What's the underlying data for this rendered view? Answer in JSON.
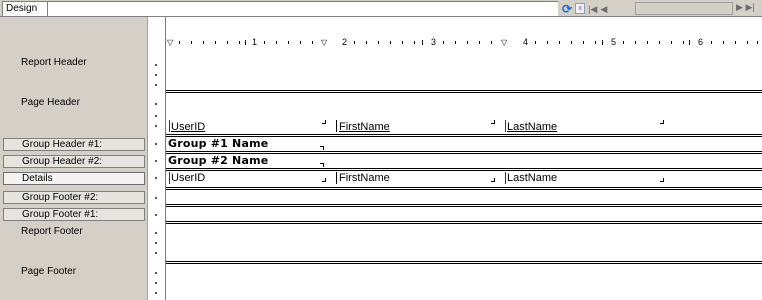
{
  "tab": {
    "label": "Design"
  },
  "sections": [
    {
      "key": "report_header",
      "label": "Report Header"
    },
    {
      "key": "page_header",
      "label": "Page Header"
    },
    {
      "key": "group_header_1",
      "label": "Group Header #1:"
    },
    {
      "key": "group_header_2",
      "label": "Group Header #2:"
    },
    {
      "key": "details",
      "label": "Details"
    },
    {
      "key": "group_footer_2",
      "label": "Group Footer #2:"
    },
    {
      "key": "group_footer_1",
      "label": "Group Footer #1:"
    },
    {
      "key": "report_footer",
      "label": "Report Footer"
    },
    {
      "key": "page_footer",
      "label": "Page Footer"
    }
  ],
  "ruler": {
    "numbers": [
      "1",
      "2",
      "3",
      "4",
      "5",
      "6"
    ]
  },
  "page_header_fields": [
    "UserID",
    "FirstName",
    "LastName"
  ],
  "group_fields": {
    "group1": "Group #1 Name",
    "group2": "Group #2 Name"
  },
  "detail_fields": [
    "UserID",
    "FirstName",
    "LastName"
  ],
  "icons": [
    "refresh-icon",
    "export-icon",
    "first-page-icon",
    "previous-page-icon",
    "next-page-icon",
    "last-page-icon"
  ]
}
